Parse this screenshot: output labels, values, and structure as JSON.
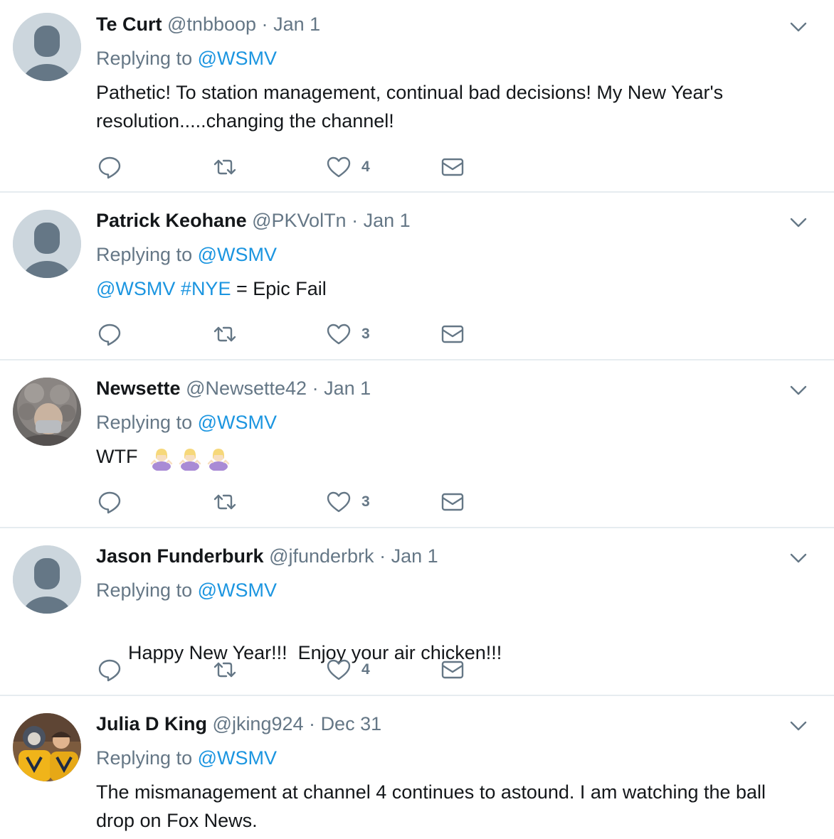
{
  "colors": {
    "link": "#1b95e0",
    "muted": "#657786",
    "text": "#14171a",
    "divider": "#e6ecf0",
    "avatar_default_bg": "#ccd6dd",
    "avatar_default_fg": "#657786"
  },
  "tweets": [
    {
      "name": "Te Curt",
      "handle": "@tnbboop",
      "sep": "·",
      "date": "Jan 1",
      "replying_prefix": "Replying to",
      "replying_to": "@WSMV",
      "text_line1": "Pathetic! To station management, continual bad decisions! My New Year's",
      "text_line2": "resolution.....changing the channel!",
      "likes": "4",
      "avatar": "default-avatar"
    },
    {
      "name": "Patrick Keohane",
      "handle": "@PKVolTn",
      "sep": "·",
      "date": "Jan 1",
      "replying_prefix": "Replying to",
      "replying_to": "@WSMV",
      "mention": "@WSMV",
      "hashtag": "#NYE",
      "text_rest": "= Epic Fail",
      "likes": "3",
      "avatar": "default-avatar"
    },
    {
      "name": "Newsette",
      "handle": "@Newsette42",
      "sep": "·",
      "date": "Jan 1",
      "replying_prefix": "Replying to",
      "replying_to": "@WSMV",
      "text": "WTF",
      "emoji": [
        "woman-shrugging-emoji",
        "woman-shrugging-emoji",
        "woman-shrugging-emoji"
      ],
      "likes": "3",
      "avatar": "photo-avatar"
    },
    {
      "name": "Jason Funderburk",
      "handle": "@jfunderbrk",
      "sep": "·",
      "date": "Jan 1",
      "replying_prefix": "Replying to",
      "replying_to": "@WSMV",
      "text": "Happy New Year!!!  Enjoy your air chicken!!!",
      "likes": "4",
      "avatar": "default-avatar"
    },
    {
      "name": "Julia D King",
      "handle": "@jking924",
      "sep": "·",
      "date": "Dec 31",
      "replying_prefix": "Replying to",
      "replying_to": "@WSMV",
      "text_line1": "The mismanagement at channel 4 continues to astound. I am watching the ball",
      "text_line2": "drop on Fox News.",
      "avatar": "photo-avatar"
    }
  ],
  "icons": {
    "reply": "reply-icon",
    "retweet": "retweet-icon",
    "like": "heart-icon",
    "dm": "envelope-icon",
    "more": "chevron-down-icon"
  }
}
